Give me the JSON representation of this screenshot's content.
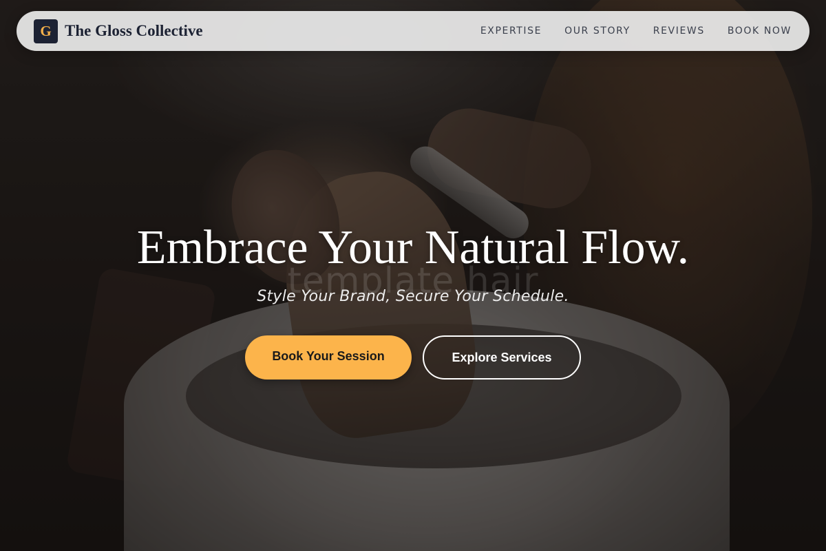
{
  "nav": {
    "logo_letter": "G",
    "brand_name": "The Gloss Collective",
    "links": [
      "EXPERTISE",
      "OUR STORY",
      "REVIEWS",
      "BOOK NOW"
    ]
  },
  "hero": {
    "headline": "Embrace Your Natural Flow.",
    "watermark": "template hair",
    "tagline": "Style Your Brand, Secure Your Schedule.",
    "primary_cta": "Book Your Session",
    "secondary_cta": "Explore Services",
    "background_image": "salon-hair-wash-photo"
  },
  "colors": {
    "accent": "#fcb44b",
    "navy": "#1c2233",
    "nav_bg": "#ececec"
  }
}
